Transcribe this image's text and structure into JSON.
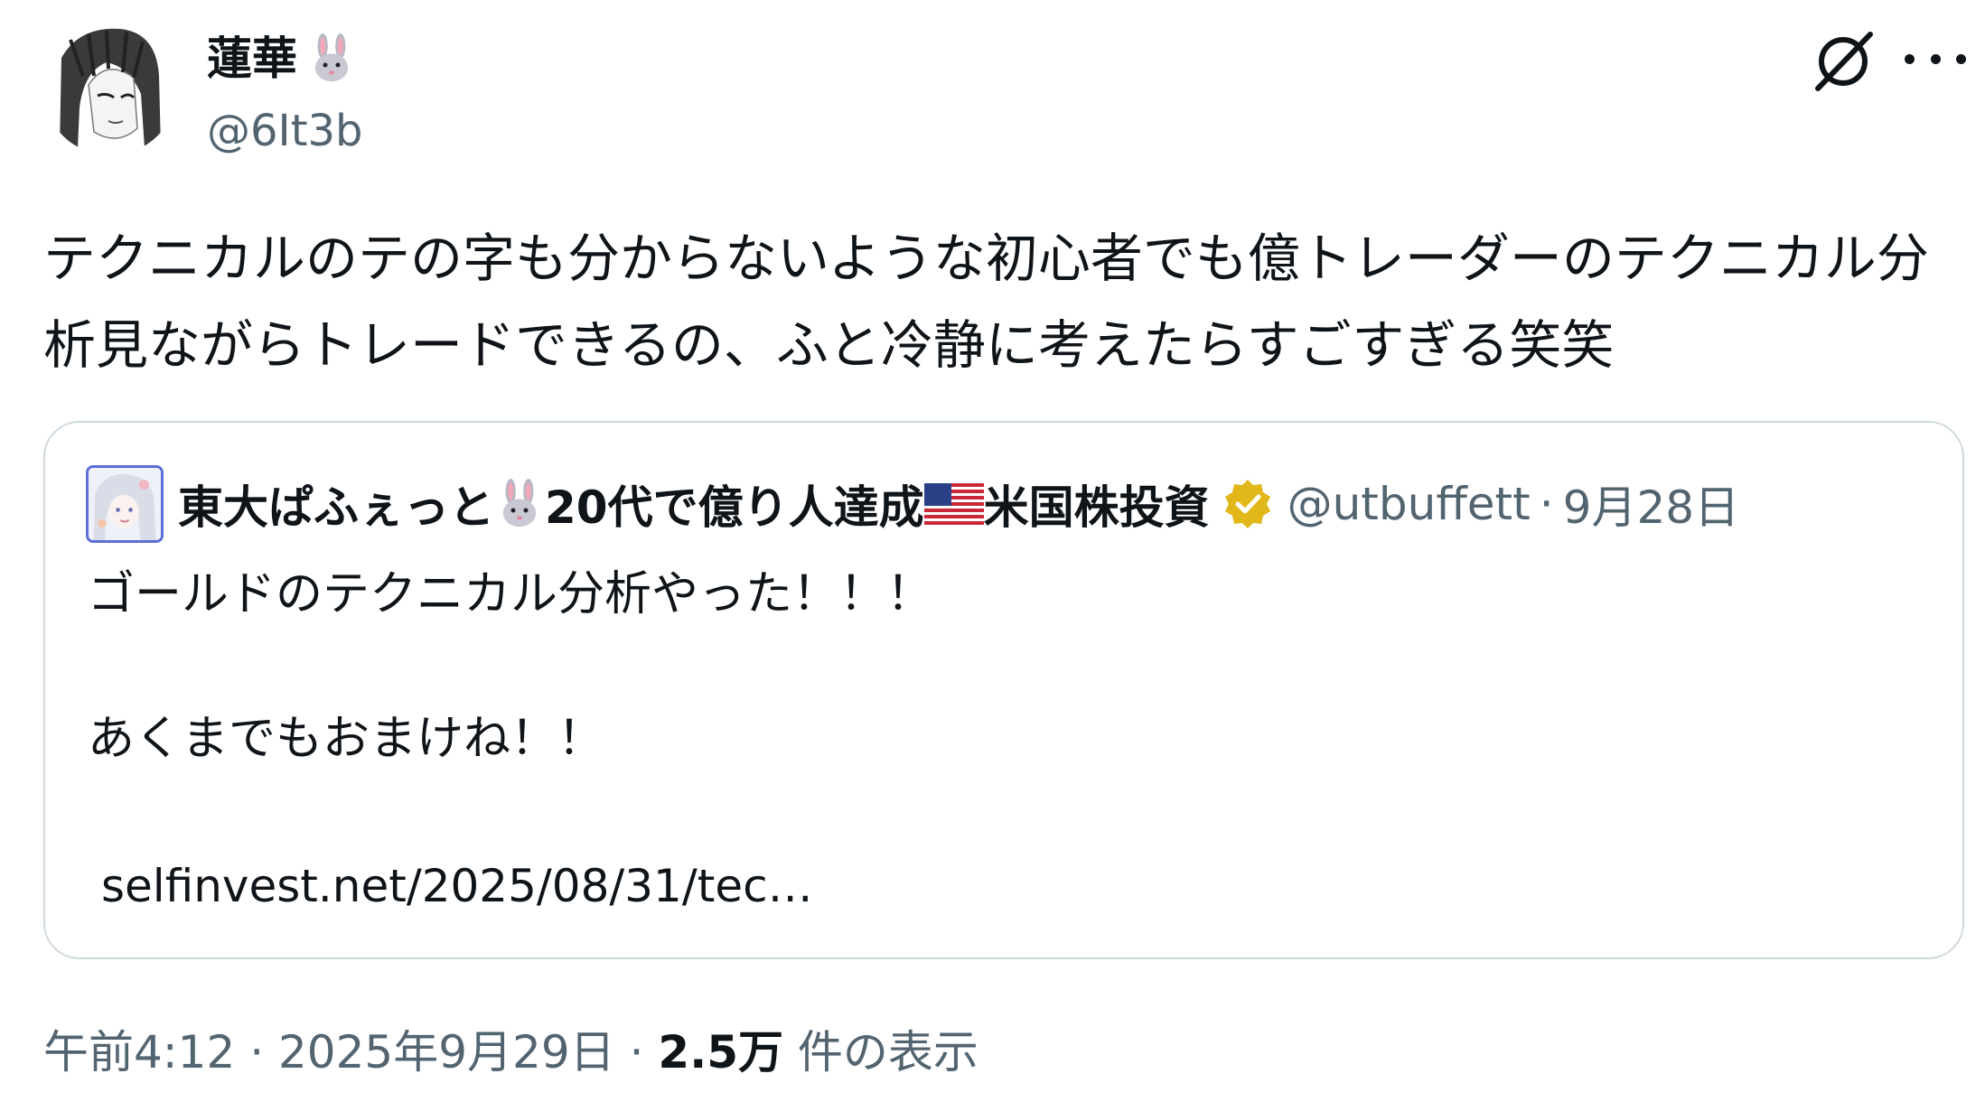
{
  "author": {
    "display_name": "蓮華",
    "name_emoji": "rabbit-face-emoji",
    "handle": "@6It3b"
  },
  "actions": {
    "grok_icon": "grok-slash-circle-icon",
    "more_icon": "more-horizontal-icon"
  },
  "tweet": {
    "text": "テクニカルのテの字も分からないような初心者でも億トレーダーのテクニカル分析見ながらトレードできるの、ふと冷静に考えたらすごすぎる笑笑"
  },
  "quote": {
    "name_part1": "東大ぱふぇっと",
    "name_part2": "20代で億り人達成",
    "name_part3": "米国株投資",
    "name_emojis": [
      "rabbit-face-emoji",
      "us-flag-emoji"
    ],
    "verified_icon": "verified-badge-icon",
    "verified_color": "#e2b719",
    "handle": "@utbuffett",
    "separator": "·",
    "date": "9月28日",
    "text": "ゴールドのテクニカル分析やった！！！\n\nあくまでもおまけね！！",
    "link": "selfinvest.net/2025/08/31/tec…"
  },
  "meta": {
    "time": "午前4:12",
    "sep1": "·",
    "date": "2025年9月29日",
    "sep2": "·",
    "views_count": "2.5万",
    "views_label": "件の表示"
  },
  "colors": {
    "text_primary": "#0f1419",
    "text_secondary": "#536471",
    "border": "#cfd9de"
  }
}
